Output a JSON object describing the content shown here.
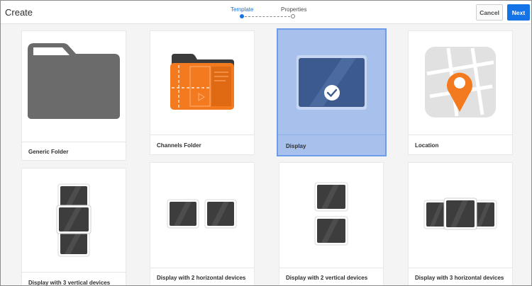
{
  "header": {
    "title": "Create",
    "steps": [
      {
        "label": "Template",
        "active": true
      },
      {
        "label": "Properties",
        "active": false
      }
    ],
    "cancel_label": "Cancel",
    "next_label": "Next"
  },
  "templates": [
    {
      "label": "Generic Folder",
      "icon": "folder-icon",
      "selected": false
    },
    {
      "label": "Channels Folder",
      "icon": "channels-folder-icon",
      "selected": false
    },
    {
      "label": "Display",
      "icon": "display-icon",
      "selected": true
    },
    {
      "label": "Location",
      "icon": "location-map-icon",
      "selected": false
    },
    {
      "label": "Display with 3 vertical devices",
      "icon": "three-vertical-devices-icon",
      "selected": false
    },
    {
      "label": "Display with 2 horizontal devices",
      "icon": "two-horizontal-devices-icon",
      "selected": false
    },
    {
      "label": "Display with 2 vertical devices",
      "icon": "two-vertical-devices-icon",
      "selected": false
    },
    {
      "label": "Display with 3 horizontal devices",
      "icon": "three-horizontal-devices-icon",
      "selected": false
    }
  ],
  "colors": {
    "accent": "#1473e6",
    "selected_card": "#a7c1ec",
    "channels_orange": "#f47a1f",
    "location_orange": "#f47a1f"
  }
}
